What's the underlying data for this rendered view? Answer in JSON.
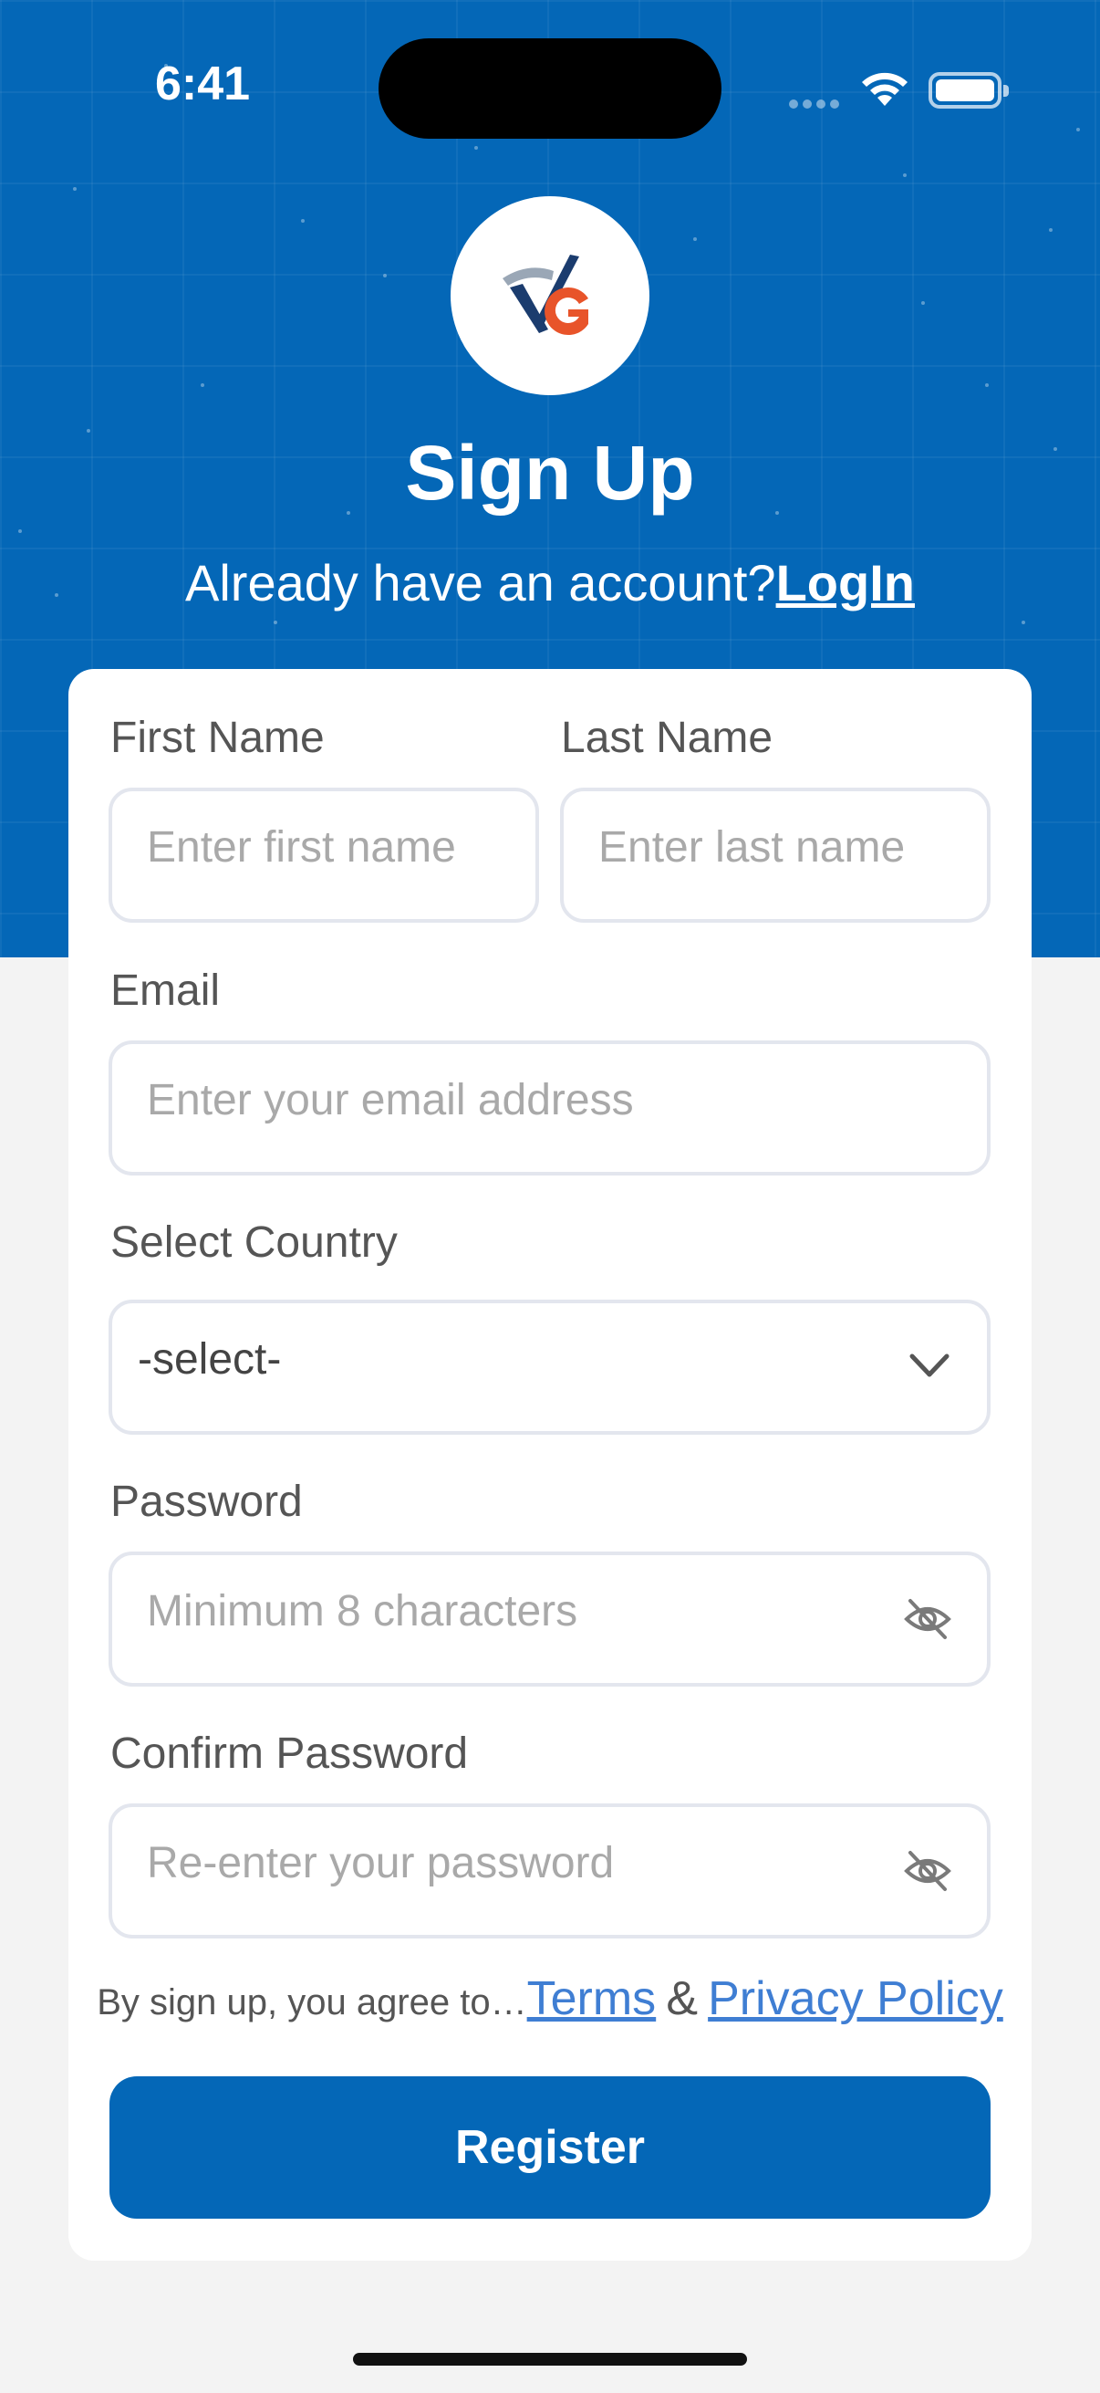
{
  "status": {
    "time": "6:41"
  },
  "header": {
    "title": "Sign Up",
    "subtitle_prefix": "Already have an account?",
    "login_link": "LogIn"
  },
  "form": {
    "first_name": {
      "label": "First Name",
      "placeholder": "Enter first name"
    },
    "last_name": {
      "label": "Last Name",
      "placeholder": "Enter last name"
    },
    "email": {
      "label": "Email",
      "placeholder": "Enter your email address"
    },
    "country": {
      "label": "Select Country",
      "value": "-select-"
    },
    "password": {
      "label": "Password",
      "placeholder": "Minimum 8 characters"
    },
    "confirm_password": {
      "label": "Confirm Password",
      "placeholder": "Re-enter your password"
    }
  },
  "terms": {
    "prefix": "By sign up, you agree to…",
    "terms_link": "Terms",
    "ampersand": "&",
    "privacy_link": "Privacy Policy"
  },
  "actions": {
    "register_label": "Register"
  },
  "colors": {
    "brand_blue": "#0467b7",
    "link_blue": "#3f7ed3",
    "logo_orange": "#e8542a",
    "logo_navy": "#1b3c6e"
  }
}
